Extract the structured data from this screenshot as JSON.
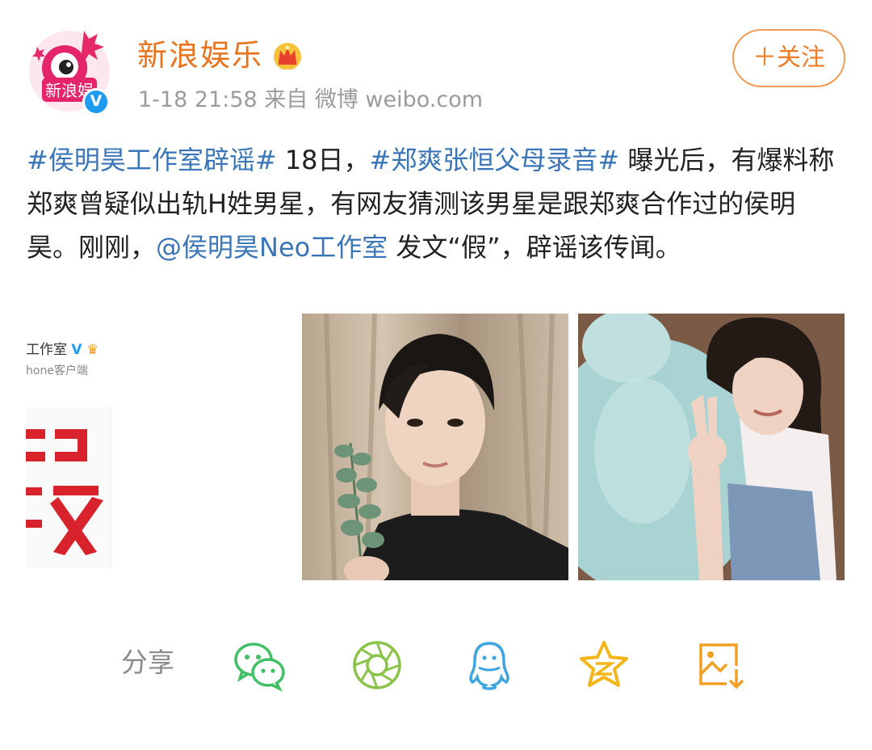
{
  "header": {
    "username": "新浪娱乐",
    "meta": "1-18 21:58   来自 微博 weibo.com",
    "follow_label": "＋关注",
    "avatar_text": "新浪娱",
    "verified_mark": "V"
  },
  "post": {
    "topic1": "#侯明昊工作室辟谣#",
    "text1": " 18日，",
    "topic2": "#郑爽张恒父母录音#",
    "text2": " 曝光后，有爆料称郑爽曾疑似出轨H姓男星，有网友猜测该男星是跟郑爽合作过的侯明昊。刚刚，",
    "mention": "@侯明昊Neo工作室",
    "text3": " 发文“假”，辟谣该传闻。"
  },
  "images": {
    "first": {
      "line1": "工作室",
      "line2": "hone客户端"
    }
  },
  "share": {
    "label": "分享"
  },
  "colors": {
    "brand_orange": "#e8731c",
    "topic_blue": "#3a76b7",
    "wechat_green": "#42c068",
    "moments_green": "#8bc34a",
    "qq_blue": "#3fa6e0",
    "qzone_yellow": "#f3b51a",
    "save_orange": "#f1a025"
  },
  "icons": [
    "wechat-icon",
    "moments-icon",
    "qq-icon",
    "qzone-icon",
    "save-image-icon",
    "crown-icon",
    "verified-icon"
  ]
}
